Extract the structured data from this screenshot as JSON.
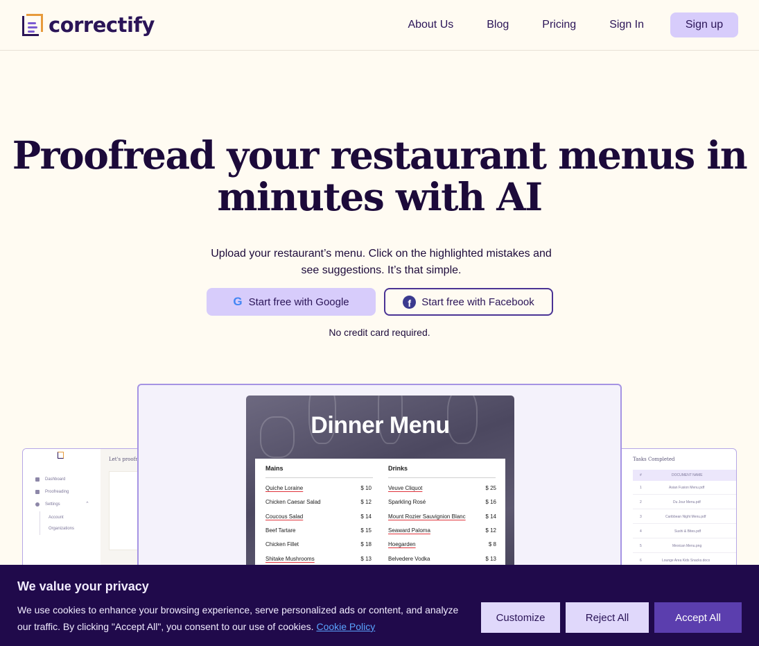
{
  "brand": {
    "name": "correctify"
  },
  "nav": {
    "about": "About Us",
    "blog": "Blog",
    "pricing": "Pricing",
    "signin": "Sign In",
    "signup": "Sign up"
  },
  "hero": {
    "title_line1": "Proofread your restaurant menus in",
    "title_line2": "minutes with AI",
    "subtitle_line1": "Upload your restaurant’s menu. Click on the highlighted mistakes and",
    "subtitle_line2": "see suggestions. It’s that simple.",
    "google_btn": "Start free with Google",
    "facebook_btn": "Start free with Facebook",
    "no_cc": "No credit card required."
  },
  "left_preview": {
    "greeting": "Let's proofre",
    "items": {
      "dashboard": "Dashboard",
      "proofreading": "Proofreading",
      "settings": "Settings",
      "account": "Account",
      "organizations": "Organizations"
    }
  },
  "right_preview": {
    "title": "Tasks Completed",
    "col_num": "#",
    "col_doc": "DOCUMENT NAME",
    "rows": [
      {
        "n": "1",
        "name": "Asian Fusion Menu.pdf"
      },
      {
        "n": "2",
        "name": "Du Jour Menu.pdf"
      },
      {
        "n": "3",
        "name": "Caribbean Night Menu.pdf"
      },
      {
        "n": "4",
        "name": "Sushi & Bites.pdf"
      },
      {
        "n": "5",
        "name": "Mexican Menu.png"
      },
      {
        "n": "6",
        "name": "Lounge Area Kids Snacks.docx"
      }
    ]
  },
  "menu": {
    "title": "Dinner Menu",
    "mains_head": "Mains",
    "drinks_head": "Drinks",
    "mains": [
      {
        "name": "Quiche Loraine",
        "price": "$ 10",
        "error": true
      },
      {
        "name": "Chicken Caesar Salad",
        "price": "$ 12",
        "error": false
      },
      {
        "name": "Coucous Salad",
        "price": "$ 14",
        "error": true
      },
      {
        "name": "Beef Tartare",
        "price": "$ 15",
        "error": false
      },
      {
        "name": "Chicken Fillet",
        "price": "$ 18",
        "error": false
      },
      {
        "name": "Shitake Mushrooms",
        "price": "$ 13",
        "error": true
      }
    ],
    "drinks": [
      {
        "name": "Veuve Cliquot",
        "price": "$ 25",
        "error": true
      },
      {
        "name": "Sparkling Rosé",
        "price": "$ 16",
        "error": false
      },
      {
        "name": "Mount Rozier Sauvignion Blanc",
        "price": "$ 14",
        "error": true
      },
      {
        "name": "Seaward Paloma",
        "price": "$ 12",
        "error": true
      },
      {
        "name": "Hoegarden",
        "price": "$ 8",
        "error": true
      },
      {
        "name": "Belvedere Vodka",
        "price": "$ 13",
        "error": false
      }
    ]
  },
  "cookie": {
    "title": "We value your privacy",
    "text": "We use cookies to enhance your browsing experience, serve personalized ads or content, and analyze our traffic. By clicking \"Accept All\", you consent to our use of cookies.",
    "link": "Cookie Policy",
    "customize": "Customize",
    "reject": "Reject All",
    "accept": "Accept All"
  },
  "colors": {
    "background": "#fffbf2",
    "brand_dark": "#2a1457",
    "accent_light": "#d7ccfb",
    "accent_orange": "#e79a3c",
    "cookie_bg": "#200a4b",
    "accept_btn": "#5b3eae"
  }
}
